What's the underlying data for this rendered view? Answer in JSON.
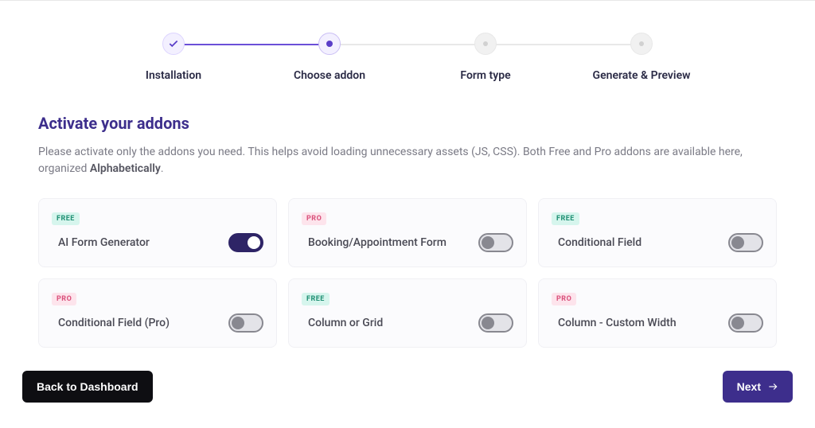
{
  "stepper": {
    "steps": [
      {
        "label": "Installation",
        "state": "completed"
      },
      {
        "label": "Choose addon",
        "state": "active"
      },
      {
        "label": "Form type",
        "state": "inactive"
      },
      {
        "label": "Generate & Preview",
        "state": "inactive"
      }
    ]
  },
  "heading": "Activate your addons",
  "subtext_pre": "Please activate only the addons you need. This helps avoid loading unnecessary assets (JS, CSS). Both Free and Pro addons are available here, organized ",
  "subtext_bold": "Alphabetically",
  "subtext_post": ".",
  "badges": {
    "free": "FREE",
    "pro": "PRO"
  },
  "addons": [
    {
      "title": "AI Form Generator",
      "tier": "free",
      "on": true
    },
    {
      "title": "Booking/Appointment Form",
      "tier": "pro",
      "on": false
    },
    {
      "title": "Conditional Field",
      "tier": "free",
      "on": false
    },
    {
      "title": "Conditional Field (Pro)",
      "tier": "pro",
      "on": false
    },
    {
      "title": "Column or Grid",
      "tier": "free",
      "on": false
    },
    {
      "title": "Column - Custom Width",
      "tier": "pro",
      "on": false
    }
  ],
  "buttons": {
    "back": "Back to Dashboard",
    "next": "Next"
  }
}
